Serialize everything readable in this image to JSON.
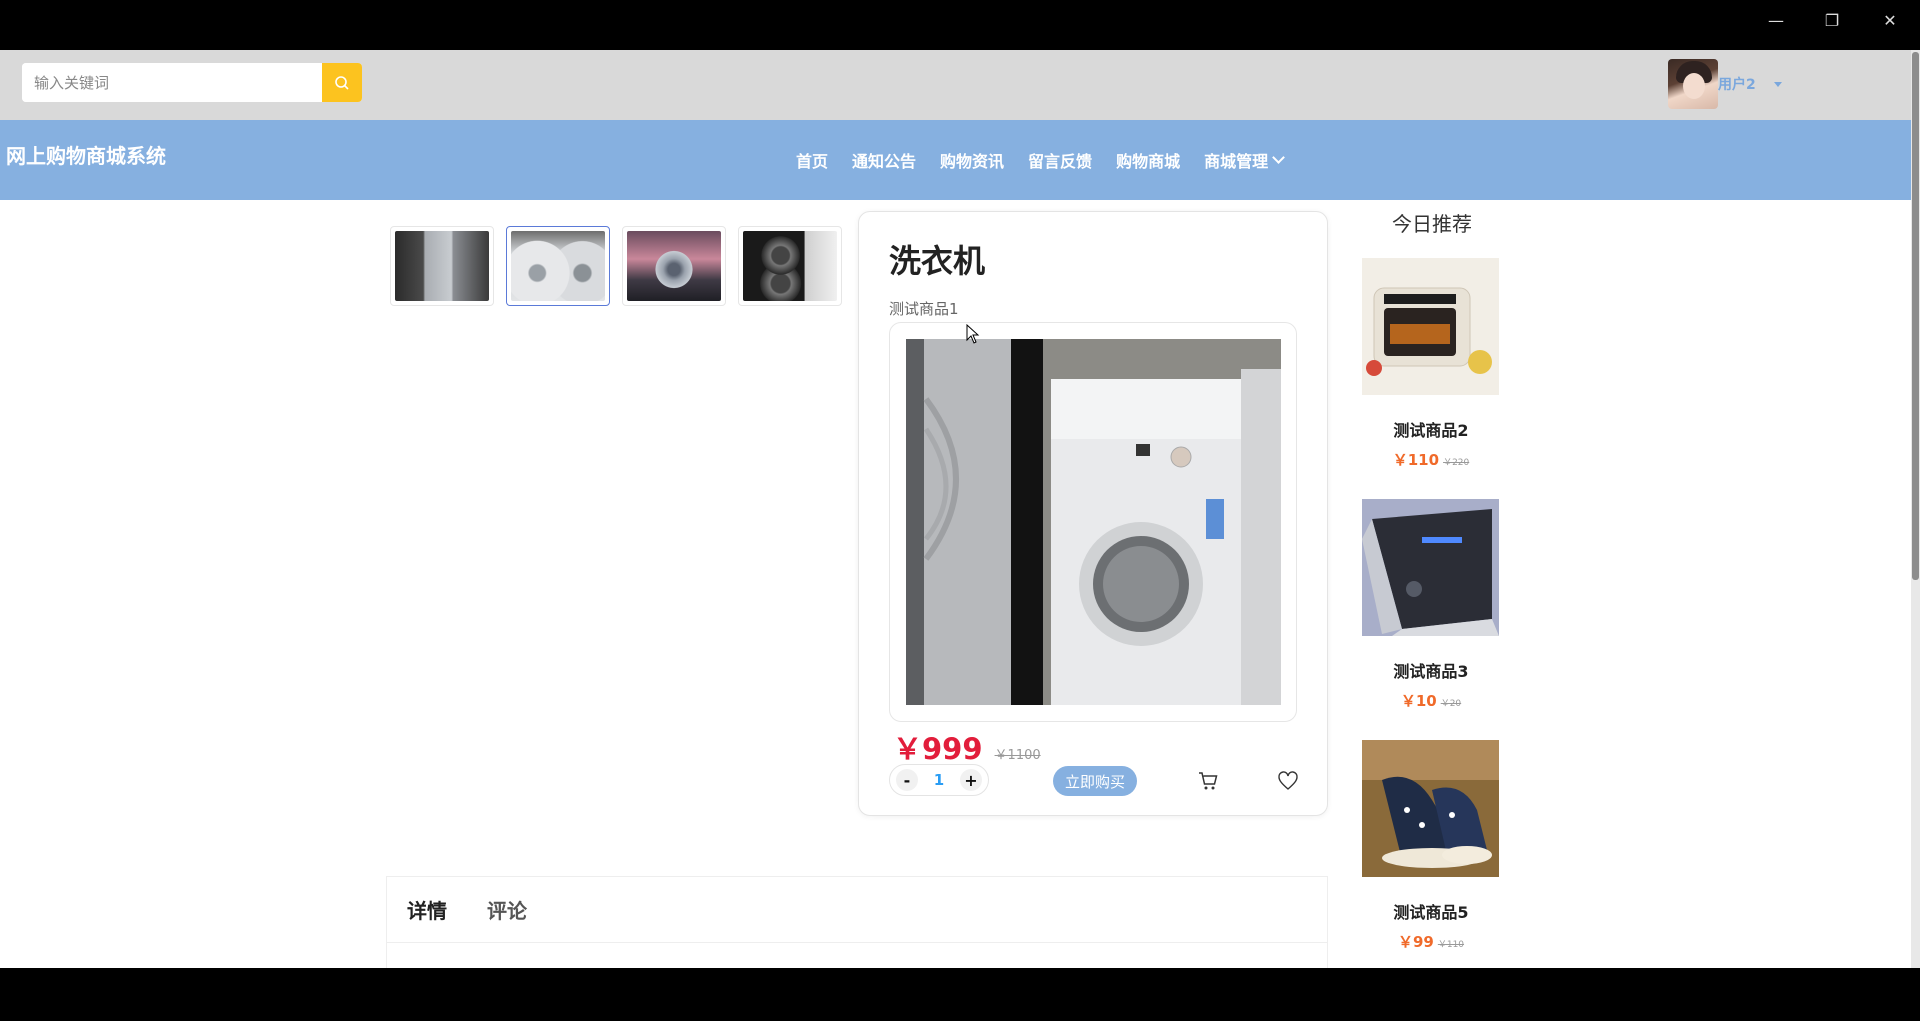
{
  "window": {
    "minimize": "—",
    "restore": "❐",
    "close": "✕"
  },
  "search": {
    "placeholder": "输入关键词"
  },
  "user": {
    "name": "用户2"
  },
  "site": {
    "title": "网上购物商城系统"
  },
  "nav": {
    "items": [
      {
        "label": "首页"
      },
      {
        "label": "通知公告"
      },
      {
        "label": "购物资讯"
      },
      {
        "label": "留言反馈"
      },
      {
        "label": "购物商城"
      },
      {
        "label": "商城管理"
      }
    ]
  },
  "product": {
    "title": "洗衣机",
    "subtitle": "测试商品1",
    "price": "￥999",
    "old_price": "￥1100",
    "quantity": "1",
    "qty_minus": "-",
    "qty_plus": "+",
    "buy_label": "立即购买"
  },
  "recommend": {
    "title": "今日推荐",
    "items": [
      {
        "name": "测试商品2",
        "price": "￥110",
        "old_price": "￥220"
      },
      {
        "name": "测试商品3",
        "price": "￥10",
        "old_price": "￥20"
      },
      {
        "name": "测试商品5",
        "price": "￥99",
        "old_price": "￥110"
      }
    ]
  },
  "tabs": [
    {
      "label": "详情"
    },
    {
      "label": "评论"
    }
  ],
  "colors": {
    "nav_bg": "#86b0e0",
    "search_btn": "#fcc31f",
    "price": "#e21d3b",
    "rec_price": "#f06a2a",
    "qty_value": "#2a9df4"
  }
}
